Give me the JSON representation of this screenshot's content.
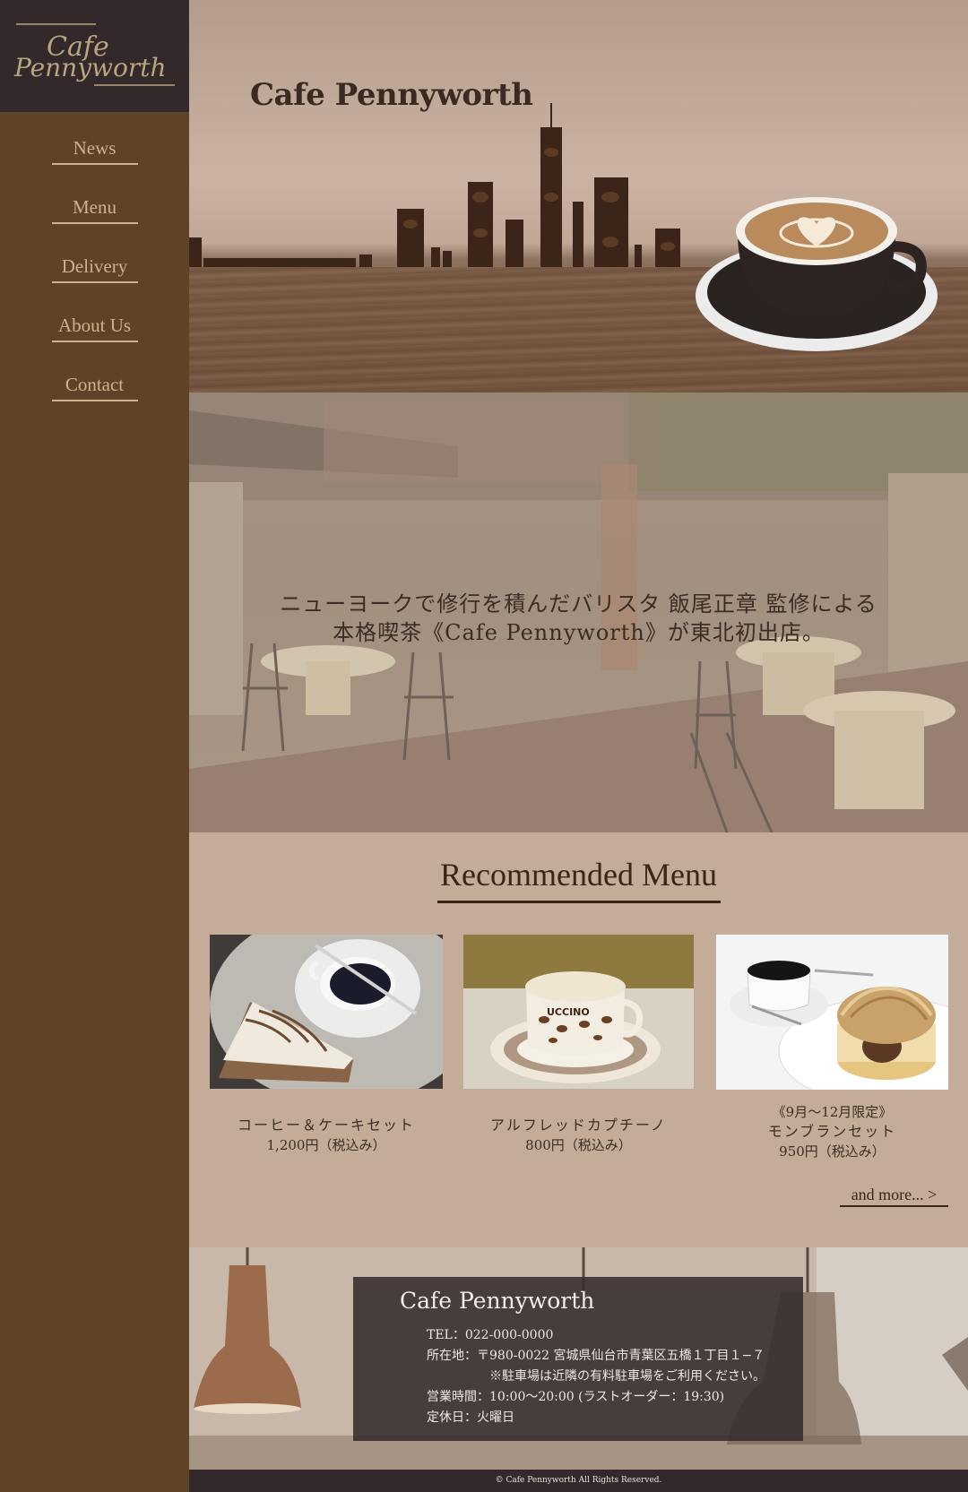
{
  "sidebar": {
    "logo": {
      "line1": "Cafe",
      "line2": "Pennyworth"
    },
    "nav": [
      {
        "label": "News"
      },
      {
        "label": "Menu"
      },
      {
        "label": "Delivery"
      },
      {
        "label": "About Us"
      },
      {
        "label": "Contact"
      }
    ]
  },
  "hero": {
    "brand": "Cafe Pennyworth"
  },
  "intro": {
    "line1": "ニューヨークで修行を積んだバリスタ 飯尾正章 監修による",
    "line2": "本格喫茶《Cafe Pennyworth》が東北初出店。"
  },
  "recommended": {
    "title": "Recommended Menu",
    "items": [
      {
        "name": "コーヒー＆ケーキセット",
        "price": "1,200円（税込み）"
      },
      {
        "name": "アルフレッドカプチーノ",
        "price": "800円（税込み）"
      },
      {
        "note": "《9月～12月限定》",
        "name": "モンブランセット",
        "price": "950円（税込み）"
      }
    ],
    "more": "and more...  >"
  },
  "info": {
    "name": "Cafe Pennyworth",
    "tel": "TEL：022-000-0000",
    "address": "所在地：〒980-0022 宮城県仙台市青葉区五橋１丁目１−７",
    "parking": "※駐車場は近隣の有料駐車場をご利用ください。",
    "hours": "営業時間：10:00〜20:00 (ラストオーダー：19:30)",
    "closed": "定休日：火曜日"
  },
  "copyright": "© Cafe Pennyworth All Rights Reserved.",
  "colors": {
    "sidebar": "#5e4326",
    "logo_bg": "#33292a",
    "nav_text": "#c9b48d",
    "content_bg": "#c4ad98",
    "heading": "#3a2616"
  }
}
